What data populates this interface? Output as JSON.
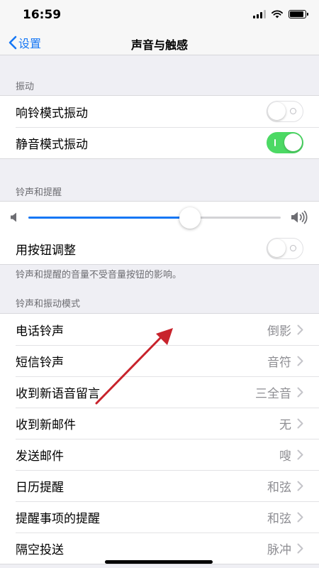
{
  "status": {
    "time": "16:59",
    "battery_level": 0.9
  },
  "nav": {
    "back_label": "设置",
    "title": "声音与触感"
  },
  "vibration": {
    "header": "振动",
    "rows": [
      {
        "label": "响铃模式振动",
        "on": false
      },
      {
        "label": "静音模式振动",
        "on": true
      }
    ]
  },
  "ringer": {
    "header": "铃声和提醒",
    "volume_level": 0.64,
    "buttons_row": {
      "label": "用按钮调整",
      "on": false
    },
    "footer": "铃声和提醒的音量不受音量按钮的影响。"
  },
  "patterns": {
    "header": "铃声和振动模式",
    "rows": [
      {
        "label": "电话铃声",
        "value": "倒影"
      },
      {
        "label": "短信铃声",
        "value": "音符"
      },
      {
        "label": "收到新语音留言",
        "value": "三全音"
      },
      {
        "label": "收到新邮件",
        "value": "无"
      },
      {
        "label": "发送邮件",
        "value": "嗖"
      },
      {
        "label": "日历提醒",
        "value": "和弦"
      },
      {
        "label": "提醒事项的提醒",
        "value": "和弦"
      },
      {
        "label": "隔空投送",
        "value": "脉冲"
      }
    ]
  },
  "colors": {
    "accent": "#1677f5",
    "toggle_on": "#4cd964",
    "annotation": "#c8232c"
  }
}
